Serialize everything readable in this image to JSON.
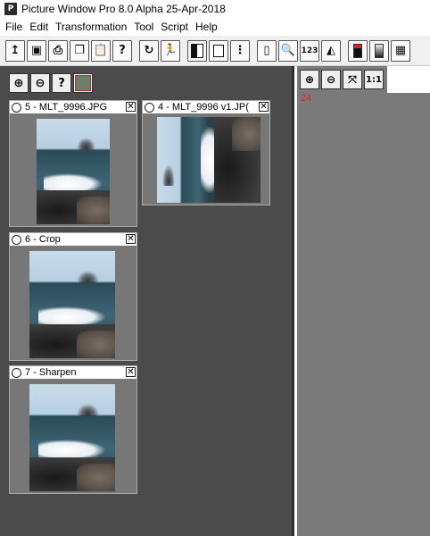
{
  "window": {
    "title": "Picture Window Pro 8.0 Alpha 25-Apr-2018",
    "icon": "app-icon"
  },
  "menu": [
    "File",
    "Edit",
    "Transformation",
    "Tool",
    "Script",
    "Help"
  ],
  "toolbar": {
    "numbers_label": "123",
    "help_label": "?"
  },
  "panel": {
    "help_label": "?"
  },
  "thumbnails": [
    {
      "label": "5 - MLT_9996.JPG"
    },
    {
      "label": "4 - MLT_9996 v1.JP("
    },
    {
      "label": "6 - Crop"
    },
    {
      "label": "7 - Sharpen"
    }
  ],
  "viewer": {
    "zoom_actual_label": "1:1",
    "readout": "24"
  },
  "colors": {
    "panel_bg": "#4b4b4b",
    "viewer_bg": "#7a7a7a",
    "readout": "#e02020"
  }
}
